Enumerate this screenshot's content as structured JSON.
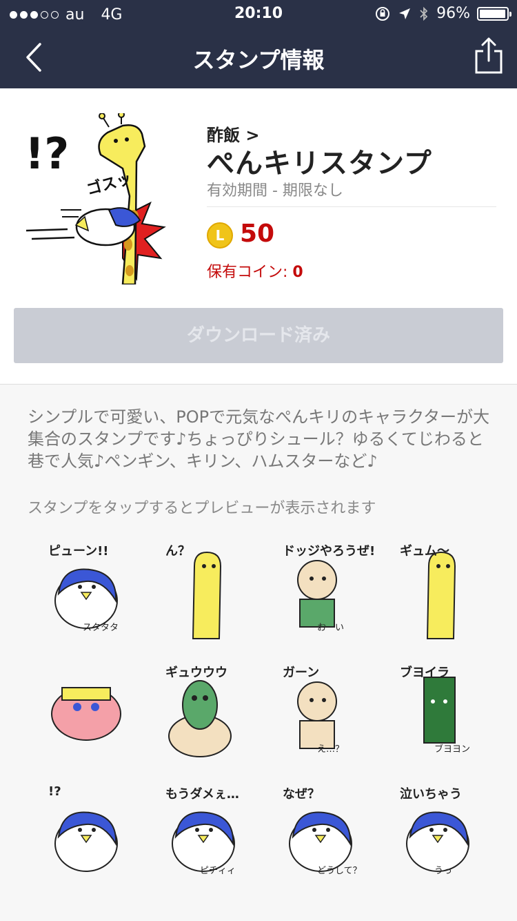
{
  "status_bar": {
    "carrier": "au",
    "network": "4G",
    "time": "20:10",
    "battery": "96%"
  },
  "nav": {
    "title": "スタンプ情報",
    "back_icon": "chevron-left-icon",
    "share_icon": "share-icon"
  },
  "sticker": {
    "author": "酢飯 >",
    "name": "ぺんキリスタンプ",
    "validity": "有効期間 - 期限なし",
    "coin_letter": "L",
    "price": "50",
    "owned_label": "保有コイン: ",
    "owned_value": "0",
    "download_label": "ダウンロード済み"
  },
  "description": "シンプルで可愛い、POPで元気なぺんキリのキャラクターが大集合のスタンプです♪ちょっぴりシュール？ゆるくてじわると巷で人気♪ペンギン、キリン、ハムスターなど♪",
  "preview_hint": "スタンプをタップするとプレビューが表示されます",
  "hero_text": {
    "exclaim": "!?",
    "sfx": "ゴスッ"
  },
  "stickers": [
    {
      "name": "penguin-pyu",
      "caption": "ピューン!!",
      "sub": "スタタタ"
    },
    {
      "name": "giraffe-n",
      "caption": "ん？",
      "sub": ""
    },
    {
      "name": "boy-dodge",
      "caption": "ドッジやろうぜ!",
      "sub": "おーい"
    },
    {
      "name": "giraffe-gyumu",
      "caption": "ギュム〜",
      "sub": ""
    },
    {
      "name": "sheep",
      "caption": "",
      "sub": ""
    },
    {
      "name": "kappa-gyuu",
      "caption": "ギュウウウ",
      "sub": ""
    },
    {
      "name": "bird-gaan",
      "caption": "ガーン",
      "sub": "え…？"
    },
    {
      "name": "green-block",
      "caption": "ブヨイラ",
      "sub": "ブヨヨン"
    },
    {
      "name": "penguin-exclaim",
      "caption": "!?",
      "sub": ""
    },
    {
      "name": "blue-bird-moudame",
      "caption": "もうダメぇ…",
      "sub": "ピチィィ"
    },
    {
      "name": "penguin-naze",
      "caption": "なぜ？",
      "sub": "どうして？"
    },
    {
      "name": "penguin-crying",
      "caption": "泣いちゃう",
      "sub": "うっ"
    }
  ],
  "colors": {
    "nav_bg": "#2a3147",
    "price_red": "#c40b0b",
    "button_disabled": "#c9ccd4",
    "coin_gold": "#f0c419"
  }
}
